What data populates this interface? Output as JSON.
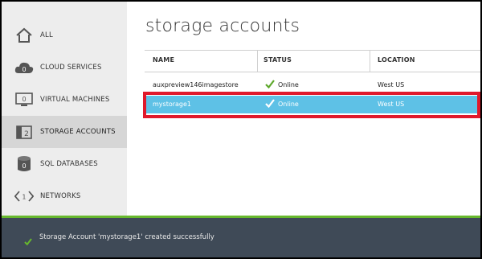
{
  "sidebar": {
    "items": [
      {
        "label": "ALL",
        "icon": "home-icon"
      },
      {
        "label": "CLOUD SERVICES",
        "icon": "cloud-icon",
        "badge": "0"
      },
      {
        "label": "VIRTUAL MACHINES",
        "icon": "monitor-icon",
        "badge": "0"
      },
      {
        "label": "STORAGE ACCOUNTS",
        "icon": "storage-icon",
        "badge": "2"
      },
      {
        "label": "SQL DATABASES",
        "icon": "database-icon",
        "badge": "0"
      },
      {
        "label": "NETWORKS",
        "icon": "network-icon",
        "badge": "1"
      }
    ],
    "active_index": 3
  },
  "main": {
    "title": "storage accounts",
    "columns": [
      "NAME",
      "STATUS",
      "LOCATION"
    ],
    "rows": [
      {
        "name": "auxpreview146imagestore",
        "status": "Online",
        "location": "West US"
      },
      {
        "name": "mystorage1",
        "status": "Online",
        "location": "West US"
      }
    ],
    "selected_row_index": 1
  },
  "notification": {
    "message": "Storage Account 'mystorage1' created successfully",
    "icon": "check-icon"
  },
  "colors": {
    "status_green": "#5da82b",
    "selected_row": "#5ec1e6",
    "highlight_outline": "#e0192b",
    "notification_bg": "#3f4a57",
    "notification_accent": "#67b82d"
  }
}
